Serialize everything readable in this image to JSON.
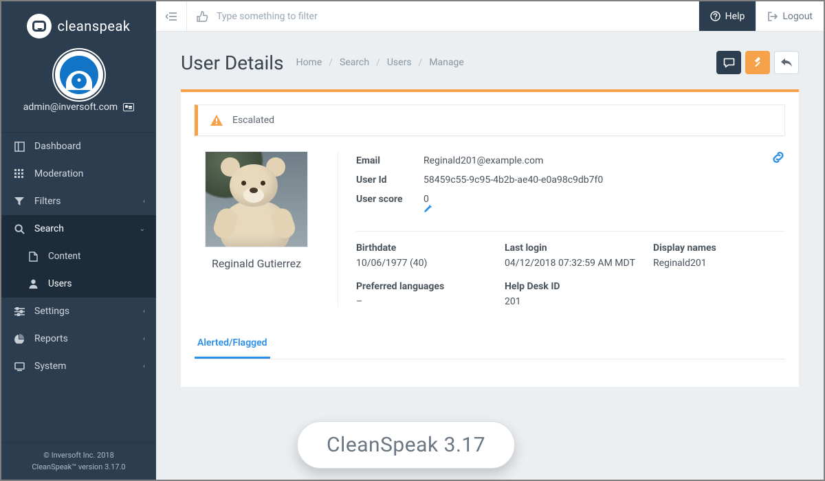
{
  "brand": {
    "name": "cleanspeak"
  },
  "user_bar": {
    "email": "admin@inversoft.com"
  },
  "sidebar": {
    "items": [
      {
        "label": "Dashboard"
      },
      {
        "label": "Moderation"
      },
      {
        "label": "Filters"
      },
      {
        "label": "Search"
      },
      {
        "label": "Settings"
      },
      {
        "label": "Reports"
      },
      {
        "label": "System"
      }
    ],
    "search_children": [
      {
        "label": "Content"
      },
      {
        "label": "Users"
      }
    ]
  },
  "footer": {
    "line1": "© Inversoft Inc. 2018",
    "line2": "CleanSpeak™ version 3.17.0"
  },
  "topbar": {
    "filter_placeholder": "Type something to filter",
    "help": "Help",
    "logout": "Logout"
  },
  "page": {
    "title": "User Details",
    "crumbs": [
      "Home",
      "Search",
      "Users",
      "Manage"
    ]
  },
  "alert": {
    "label": "Escalated"
  },
  "profile": {
    "display_name": "Reginald Gutierrez",
    "email_label": "Email",
    "email": "Reginald201@example.com",
    "userid_label": "User Id",
    "userid": "58459c55-9c95-4b2b-ae40-e0a98c9db7f0",
    "score_label": "User score",
    "score": "0",
    "fields": {
      "birthdate_label": "Birthdate",
      "birthdate": "10/06/1977 (40)",
      "lastlogin_label": "Last login",
      "lastlogin": "04/12/2018 07:32:59 AM MDT",
      "displaynames_label": "Display names",
      "displaynames": "Reginald201",
      "preflang_label": "Preferred languages",
      "preflang": "–",
      "helpdesk_label": "Help Desk ID",
      "helpdesk": "201"
    }
  },
  "tabs": {
    "active": "Alerted/Flagged"
  },
  "overlay": {
    "version_pill": "CleanSpeak 3.17"
  }
}
